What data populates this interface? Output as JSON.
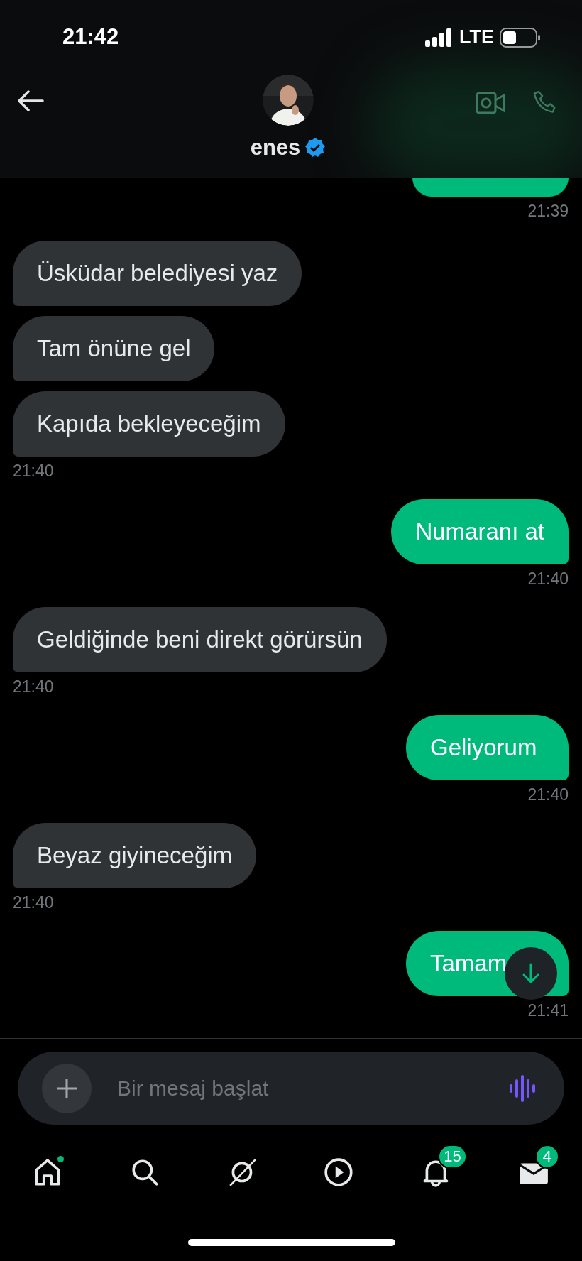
{
  "status_bar": {
    "time": "21:42",
    "network": "LTE"
  },
  "header": {
    "name": "enes",
    "verified": true
  },
  "messages": [
    {
      "kind": "cut_bubble_out"
    },
    {
      "kind": "time_out",
      "text": "21:39"
    },
    {
      "kind": "bubble_in",
      "text": "Üsküdar belediyesi yaz"
    },
    {
      "kind": "bubble_in",
      "text": "Tam önüne gel"
    },
    {
      "kind": "bubble_in",
      "text": "Kapıda bekleyeceğim"
    },
    {
      "kind": "time_in",
      "text": "21:40"
    },
    {
      "kind": "bubble_out",
      "text": "Numaranı at"
    },
    {
      "kind": "time_out",
      "text": "21:40"
    },
    {
      "kind": "bubble_in",
      "text": "Geldiğinde beni direkt görürsün"
    },
    {
      "kind": "time_in",
      "text": "21:40"
    },
    {
      "kind": "bubble_out",
      "text": "Geliyorum"
    },
    {
      "kind": "time_out",
      "text": "21:40"
    },
    {
      "kind": "bubble_in",
      "text": "Beyaz giyineceğim"
    },
    {
      "kind": "time_in",
      "text": "21:40"
    },
    {
      "kind": "bubble_out",
      "text": "Tamam"
    },
    {
      "kind": "time_out",
      "text": "21:41"
    }
  ],
  "composer": {
    "placeholder": "Bir mesaj başlat"
  },
  "nav": [
    {
      "kind": "home",
      "dot": true
    },
    {
      "kind": "search"
    },
    {
      "kind": "grok"
    },
    {
      "kind": "play"
    },
    {
      "kind": "bell",
      "badge": "15"
    },
    {
      "kind": "mail",
      "badge": "4"
    }
  ]
}
